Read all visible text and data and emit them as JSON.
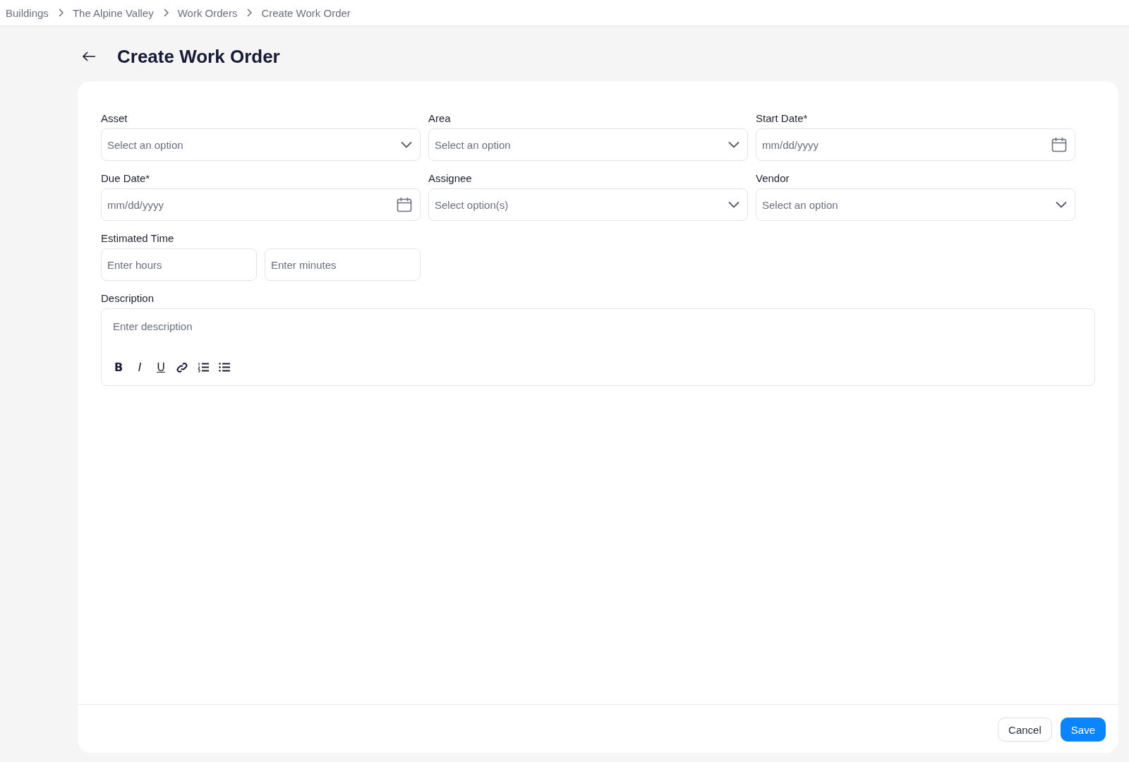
{
  "breadcrumb": [
    "Buildings",
    "The Alpine Valley",
    "Work Orders",
    "Create Work Order"
  ],
  "title": "Create Work Order",
  "fields": [
    {
      "label": "Asset",
      "kind": "select",
      "placeholder": "Select an option"
    },
    {
      "label": "Area",
      "kind": "select",
      "placeholder": "Select an option"
    },
    {
      "label": "Start Date*",
      "kind": "date",
      "placeholder": "mm/dd/yyyy"
    },
    {
      "label": "Due Date*",
      "kind": "date",
      "placeholder": "mm/dd/yyyy"
    },
    {
      "label": "Assignee",
      "kind": "select",
      "placeholder": "Select option(s)"
    },
    {
      "label": "Vendor",
      "kind": "select",
      "placeholder": "Select an option"
    },
    {
      "label": "Estimated Time",
      "kind": "pair",
      "placeholders": [
        "Enter hours",
        "Enter minutes"
      ]
    }
  ],
  "description": {
    "label": "Description",
    "placeholder": "Enter description",
    "format_buttons": [
      {
        "kind": "bold",
        "text": "B"
      },
      {
        "kind": "italic",
        "text": "I"
      },
      {
        "kind": "underline",
        "text": "U"
      },
      {
        "kind": "link"
      },
      {
        "kind": "ordered"
      },
      {
        "kind": "bullets"
      }
    ]
  },
  "buttons": [
    {
      "label": "Cancel",
      "kind": "secondary"
    },
    {
      "label": "Save",
      "kind": "primary"
    }
  ]
}
